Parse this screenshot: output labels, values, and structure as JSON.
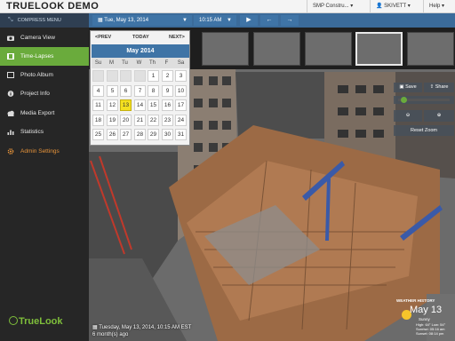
{
  "app": {
    "title": "TRUELOOK DEMO"
  },
  "topbar": {
    "project": "SMP Constru...",
    "user": "SKIVETT",
    "help": "Help"
  },
  "toolbar": {
    "compress_label": "COMPRESS MENU",
    "date_value": "Tue, May 13, 2014",
    "time_value": "10:15 AM"
  },
  "sidebar": {
    "items": [
      {
        "label": "Camera View",
        "icon": "camera-icon"
      },
      {
        "label": "Time-Lapses",
        "icon": "film-icon"
      },
      {
        "label": "Photo Album",
        "icon": "photo-icon"
      },
      {
        "label": "Project Info",
        "icon": "info-icon"
      },
      {
        "label": "Media Export",
        "icon": "cloud-icon"
      },
      {
        "label": "Statistics",
        "icon": "chart-icon"
      },
      {
        "label": "Admin Settings",
        "icon": "gear-icon"
      }
    ],
    "logo_text": "TrueLook"
  },
  "calendar": {
    "prev": "<PREV",
    "today": "TODAY",
    "next": "NEXT>",
    "month": "May 2014",
    "dow": [
      "Su",
      "M",
      "Tu",
      "W",
      "Th",
      "F",
      "Sa"
    ],
    "weeks": [
      [
        "",
        "",
        "",
        "",
        "1",
        "2",
        "3"
      ],
      [
        "4",
        "5",
        "6",
        "7",
        "8",
        "9",
        "10"
      ],
      [
        "11",
        "12",
        "13",
        "14",
        "15",
        "16",
        "17"
      ],
      [
        "18",
        "19",
        "20",
        "21",
        "22",
        "23",
        "24"
      ],
      [
        "25",
        "26",
        "27",
        "28",
        "29",
        "30",
        "31"
      ]
    ],
    "selected": "13"
  },
  "controls": {
    "save": "Save",
    "share": "Share",
    "reset_zoom": "Reset Zoom"
  },
  "weather": {
    "title": "WEATHER HISTORY",
    "date": "May 13",
    "condition": "Sunny",
    "high_low": "High: 64° Low: 54°",
    "sunrise": "Sunrise: 05:16 am",
    "sunset": "Sunset: 08:14 pm"
  },
  "stamp": {
    "line1": "Tuesday, May 13, 2014, 10:15 AM EST",
    "line2": "6 month(s) ago"
  },
  "colors": {
    "accent_blue": "#3f74a6",
    "active_green": "#6aab3c",
    "admin_orange": "#e8943a",
    "today_yellow": "#f4e020"
  }
}
